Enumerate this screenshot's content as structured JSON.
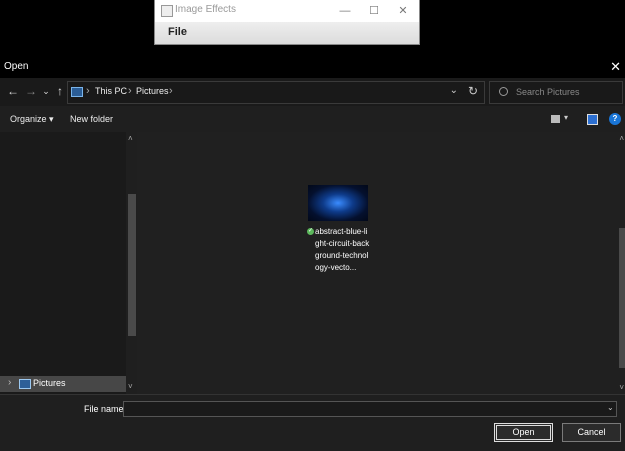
{
  "bg_window": {
    "title": "Image Effects",
    "minimize_glyph": "—",
    "maximize_glyph": "☐",
    "close_glyph": "✕",
    "menu_file": "File"
  },
  "dialog": {
    "title": "Open",
    "close_glyph": "✕"
  },
  "nav": {
    "back_glyph": "←",
    "forward_glyph": "→",
    "recent_glyph": "⌄",
    "up_glyph": "↑",
    "breadcrumbs": [
      "This PC",
      "Pictures"
    ],
    "separator_glyph": "›",
    "dropdown_glyph": "⌄",
    "refresh_glyph": "↻",
    "search_placeholder": "Search Pictures"
  },
  "toolbar": {
    "organize_label": "Organize ▾",
    "new_folder_label": "New folder",
    "view_dd_glyph": "▾",
    "help_glyph": "?"
  },
  "nav_pane": {
    "scroll_up_glyph": "˄",
    "scroll_down_glyph": "˅",
    "items": [
      {
        "label": "Pictures",
        "chevron": "›",
        "icon": "pictures-folder-icon",
        "selected": true
      }
    ]
  },
  "content": {
    "scroll_up_glyph": "˄",
    "scroll_down_glyph": "˅",
    "files": [
      {
        "name": "abstract-blue-light-circuit-background-technology-vecto...",
        "status": "synced",
        "status_glyph": "✓"
      }
    ]
  },
  "bottom": {
    "file_name_label": "File name:",
    "file_name_value": "",
    "dd_glyph": "⌄",
    "open_label": "Open",
    "cancel_label": "Cancel"
  },
  "colors": {
    "dialog_bg": "#1f1f1f",
    "accent": "#1975d6",
    "selection": "#474747",
    "status_ok": "#5cb85c"
  }
}
